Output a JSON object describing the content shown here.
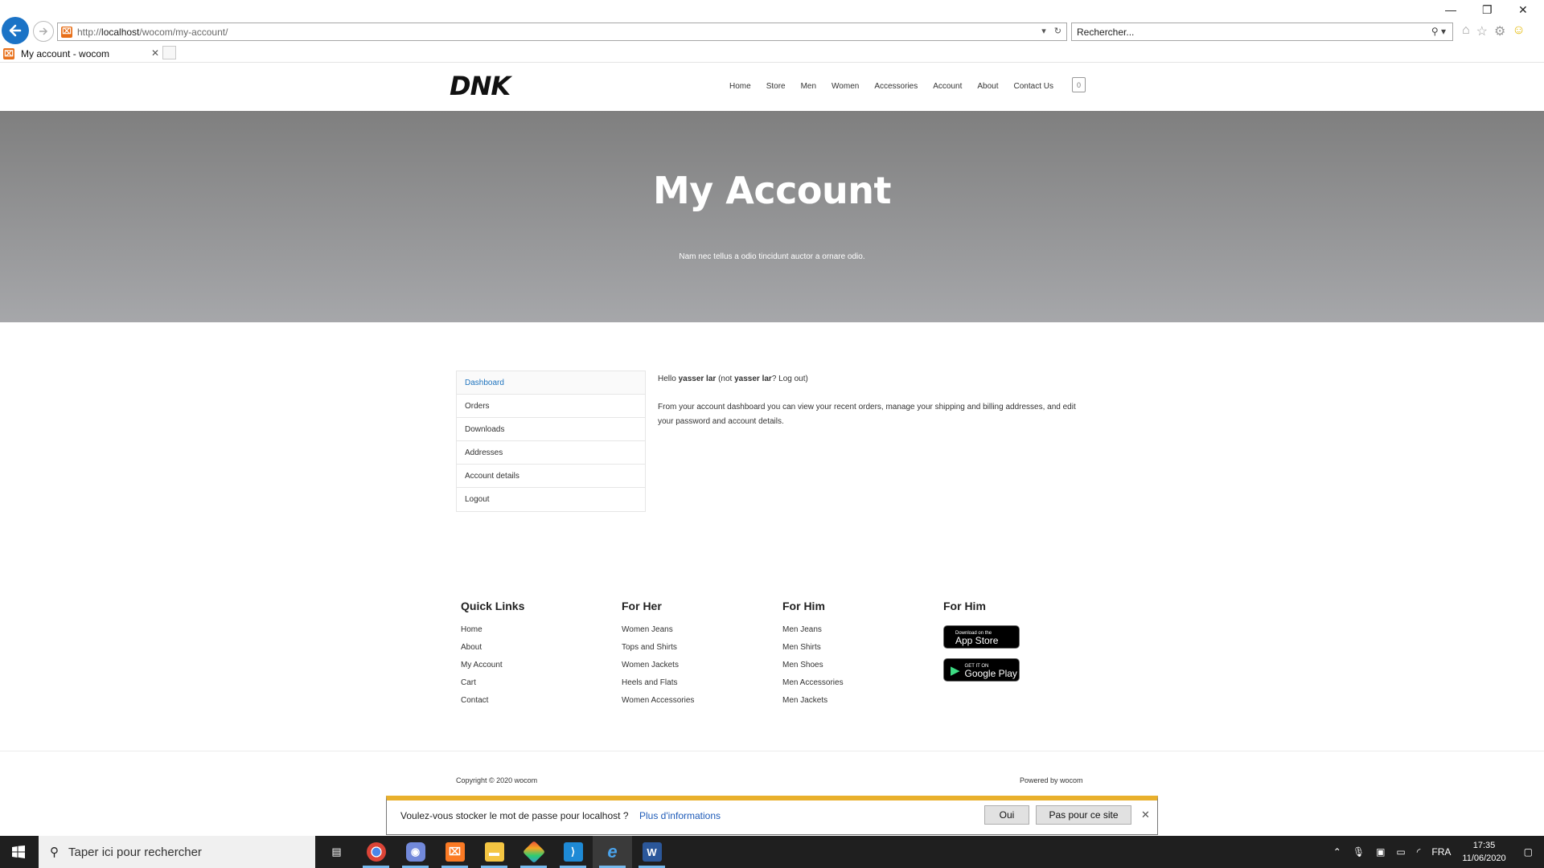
{
  "browser": {
    "url_prefix": "http://",
    "url_host": "localhost",
    "url_path": "/wocom/my-account/",
    "search_placeholder": "Rechercher...",
    "tab_title": "My account - wocom",
    "favicon_color": "#e8701a"
  },
  "site": {
    "logo": "DNK",
    "nav": [
      "Home",
      "Store",
      "Men",
      "Women",
      "Accessories",
      "Account",
      "About",
      "Contact Us"
    ],
    "cart_count": "0"
  },
  "hero": {
    "title": "My Account",
    "subtitle": "Nam nec tellus a odio tincidunt auctor a ornare odio."
  },
  "account": {
    "menu": [
      "Dashboard",
      "Orders",
      "Downloads",
      "Addresses",
      "Account details",
      "Logout"
    ],
    "active_item": "Dashboard",
    "hello_prefix": "Hello ",
    "user": "yasser lar",
    "not_prefix": " (not ",
    "not_user": "yasser lar",
    "not_suffix": "? ",
    "logout_link": "Log out",
    "close_paren": ")",
    "description": "From your account dashboard you can view your recent orders, manage your shipping and billing addresses, and edit your password and account details."
  },
  "footer": {
    "quick_links": {
      "title": "Quick Links",
      "items": [
        "Home",
        "About",
        "My Account",
        "Cart",
        "Contact"
      ]
    },
    "for_her": {
      "title": "For Her",
      "items": [
        "Women Jeans",
        "Tops and Shirts",
        "Women Jackets",
        "Heels and Flats",
        "Women Accessories"
      ]
    },
    "for_him": {
      "title": "For Him",
      "items": [
        "Men Jeans",
        "Men Shirts",
        "Men Shoes",
        "Men Accessories",
        "Men Jackets"
      ]
    },
    "apps": {
      "title": "For Him",
      "app_store_small": "Download on the",
      "app_store_large": "App Store",
      "google_small": "GET IT ON",
      "google_large": "Google Play"
    },
    "copyright": "Copyright © 2020 wocom",
    "powered": "Powered by wocom"
  },
  "password_bar": {
    "question": "Voulez-vous stocker le mot de passe pour localhost ?",
    "more_info": "Plus d'informations",
    "yes": "Oui",
    "no": "Pas pour ce site",
    "accent_color": "#e9b02c"
  },
  "taskbar": {
    "search_placeholder": "Taper ici pour rechercher",
    "language": "FRA",
    "time": "17:35",
    "date": "11/06/2020"
  }
}
